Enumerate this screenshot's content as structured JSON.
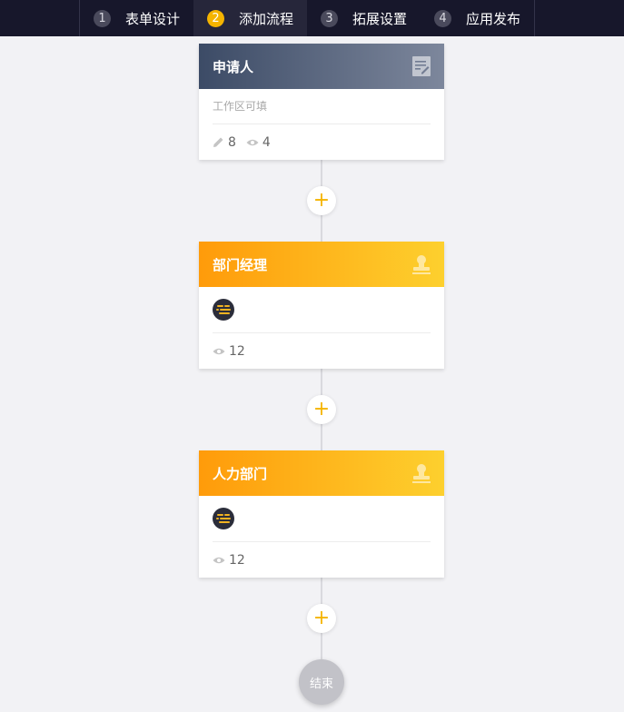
{
  "steps": [
    {
      "num": "1",
      "label": "表单设计"
    },
    {
      "num": "2",
      "label": "添加流程"
    },
    {
      "num": "3",
      "label": "拓展设置"
    },
    {
      "num": "4",
      "label": "应用发布"
    }
  ],
  "active_step": "2",
  "nodes": [
    {
      "title": "申请人",
      "desc": "工作区可填",
      "edit_count": "8",
      "view_count": "4",
      "icon": "form-edit-icon",
      "header_style": "dark"
    },
    {
      "title": "部门经理",
      "view_count": "12",
      "icon": "stamp-icon",
      "header_style": "orange"
    },
    {
      "title": "人力部门",
      "view_count": "12",
      "icon": "stamp-icon",
      "header_style": "orange"
    }
  ],
  "add_button_symbol": "+",
  "end_label": "结束",
  "colors": {
    "topbar": "#17172b",
    "accent": "#f5b400",
    "header_dark_start": "#3c4b66",
    "header_orange_start": "#ff9b0a",
    "header_orange_end": "#fdd02e",
    "background": "#f2f2f5"
  }
}
